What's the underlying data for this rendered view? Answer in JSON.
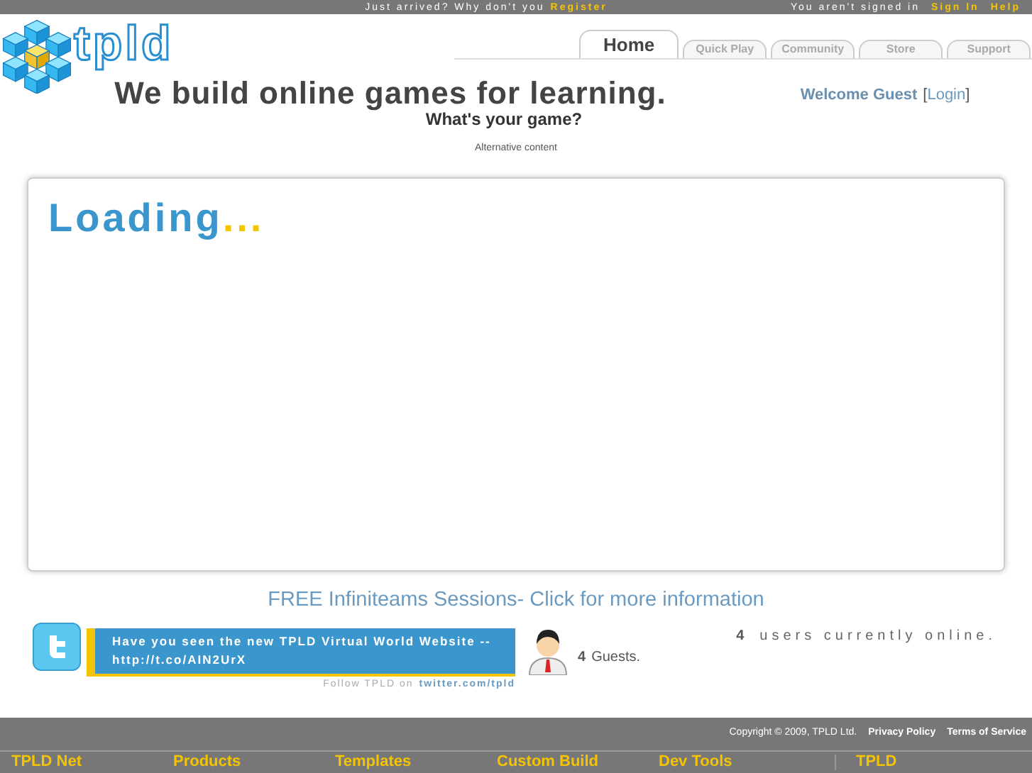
{
  "top_bar": {
    "prompt": "Just arrived? Why don't you",
    "register_link": "Register",
    "status": "You aren't signed in",
    "sign_in_link": "Sign In",
    "help_link": "Help"
  },
  "logo": {
    "text": "tpld"
  },
  "tabs": [
    {
      "label": "Home",
      "selected": true
    },
    {
      "label": "Quick Play",
      "selected": false
    },
    {
      "label": "Community",
      "selected": false
    },
    {
      "label": "Store",
      "selected": false
    },
    {
      "label": "Support",
      "selected": false
    }
  ],
  "headline": "We build online games for learning.",
  "subheadline": "What's your game?",
  "welcome": {
    "text": "Welcome Guest",
    "open_bracket": "[",
    "login_link": "Login",
    "close_bracket": "]"
  },
  "alternative_content": "Alternative content",
  "loading": {
    "text": "Loading",
    "dots": "..."
  },
  "promo_link": "FREE Infiniteams Sessions- Click for more information",
  "tweet": {
    "text": "Have you seen the new TPLD Virtual World Website -- http://t.co/AIN2UrX",
    "follow_prefix": "Follow TPLD on",
    "follow_link": "twitter.com/tpld"
  },
  "guests": {
    "count": "4",
    "label": "Guests."
  },
  "online": {
    "count": "4",
    "label": "users currently online."
  },
  "footer": {
    "copyright": "Copyright © 2009, TPLD Ltd.",
    "links": [
      "Privacy Policy",
      "Terms of Service"
    ]
  },
  "footer_columns": [
    "TPLD Net",
    "Products",
    "Templates",
    "Custom Build",
    "Dev Tools",
    "TPLD"
  ]
}
